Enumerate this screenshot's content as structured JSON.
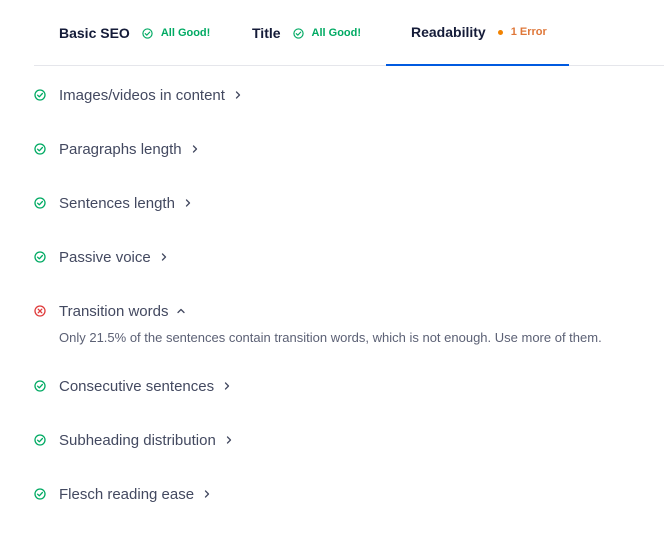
{
  "tabs": [
    {
      "label": "Basic SEO",
      "status": "All Good!",
      "state": "good"
    },
    {
      "label": "Title",
      "status": "All Good!",
      "state": "good"
    },
    {
      "label": "Readability",
      "status": "1 Error",
      "state": "error",
      "active": true
    }
  ],
  "checks": [
    {
      "title": "Images/videos in content",
      "state": "good",
      "expanded": false
    },
    {
      "title": "Paragraphs length",
      "state": "good",
      "expanded": false
    },
    {
      "title": "Sentences length",
      "state": "good",
      "expanded": false
    },
    {
      "title": "Passive voice",
      "state": "good",
      "expanded": false
    },
    {
      "title": "Transition words",
      "state": "error",
      "expanded": true,
      "description": "Only 21.5% of the sentences contain transition words, which is not enough. Use more of them."
    },
    {
      "title": "Consecutive sentences",
      "state": "good",
      "expanded": false
    },
    {
      "title": "Subheading distribution",
      "state": "good",
      "expanded": false
    },
    {
      "title": "Flesch reading ease",
      "state": "good",
      "expanded": false
    }
  ],
  "colors": {
    "good": "#00aa63",
    "error": "#df3a3a",
    "warning": "#f18200",
    "active_tab": "#005ae0"
  },
  "icons": {
    "good": "check-circle-icon",
    "error": "x-circle-icon",
    "collapsed": "chevron-right-icon",
    "expanded": "chevron-up-icon"
  }
}
